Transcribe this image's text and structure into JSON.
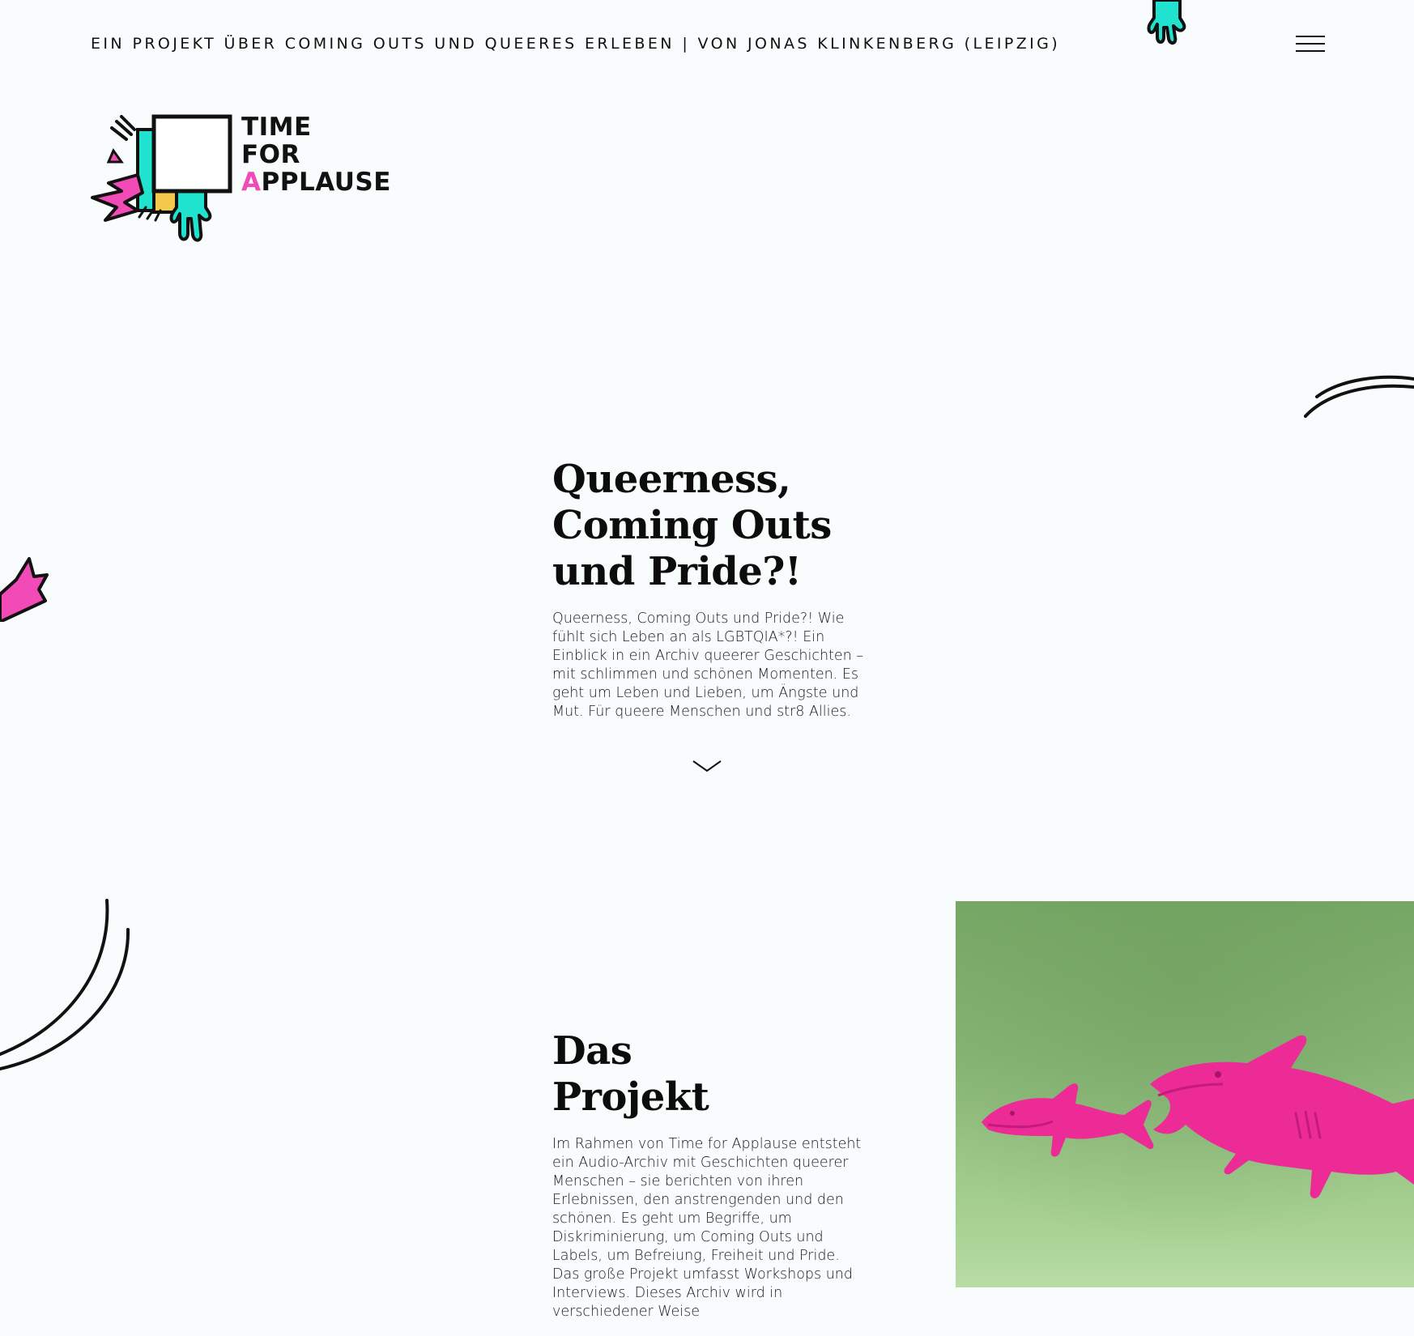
{
  "header": {
    "tagline": "EIN PROJEKT ÜBER COMING OUTS UND QUEERES ERLEBEN | VON JONAS KLINKENBERG (LEIPZIG)",
    "menu_icon": "hamburger-menu-icon"
  },
  "logo": {
    "line1": "TIME",
    "line2": "FOR",
    "line3_first": "A",
    "line3_rest": "PPLAUSE"
  },
  "hero": {
    "title_line1": "Queerness,",
    "title_line2": "Coming Outs",
    "title_line3": "und Pride?!",
    "text": "Queerness, Coming Outs und Pride?! Wie fühlt sich Leben an als LGBTQIA*?! Ein Einblick in ein Archiv queerer Geschichten – mit schlimmen und schönen Momenten. Es geht um Leben und Lieben, um Ängste und Mut. Für queere Menschen und str8 Allies.",
    "scroll_icon": "chevron-down-icon"
  },
  "project": {
    "title_line1": "Das",
    "title_line2": "Projekt",
    "text": "Im Rahmen von Time for Applause entsteht ein Audio-Archiv mit Geschichten queerer Menschen – sie berichten von ihren Erlebnissen, den anstrengenden und den schönen. Es geht um Begriffe, um Diskriminierung, um Coming Outs und Labels, um Befreiung, Freiheit und Pride. Das große Projekt umfasst Workshops und Interviews. Dieses Archiv wird in verschiedener Weise"
  },
  "colors": {
    "background": "#f8fcfc",
    "pink": "#f24bb8",
    "cyan": "#1fe3cf",
    "yellow": "#f2c94c",
    "green": "#86b474"
  }
}
